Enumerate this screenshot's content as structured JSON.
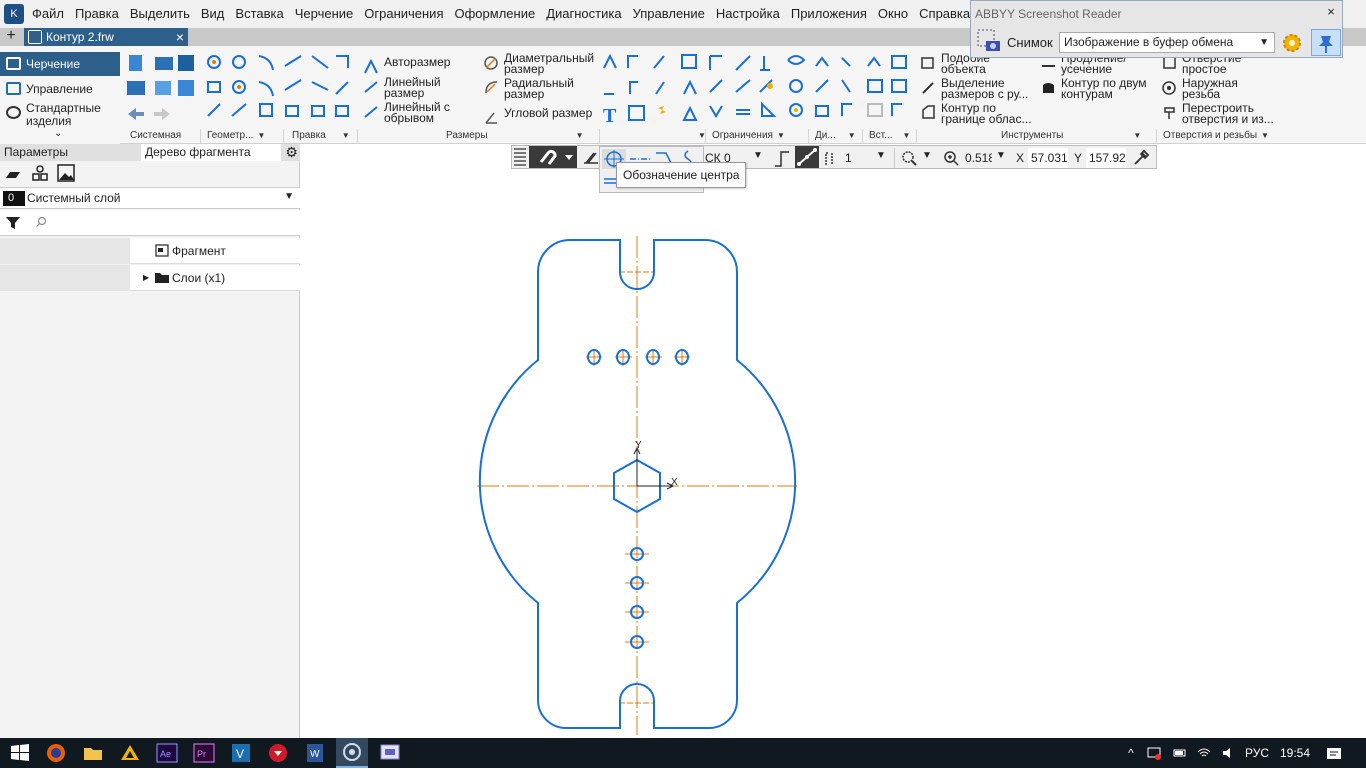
{
  "menu": {
    "items": [
      "Файл",
      "Правка",
      "Выделить",
      "Вид",
      "Вставка",
      "Черчение",
      "Ограничения",
      "Оформление",
      "Диагностика",
      "Управление",
      "Настройка",
      "Приложения",
      "Окно",
      "Справка"
    ]
  },
  "tabs": {
    "document": "Контур 2.frw"
  },
  "ribbon": {
    "modes": {
      "drawing": "Черчение",
      "management": "Управление",
      "standard": "Стандартные изделия"
    },
    "groups": {
      "system": "Системная",
      "geometry": "Геометр...",
      "edit": "Правка",
      "dimensions": "Размеры",
      "constraints": "Ограничения",
      "diagnostics": "Ди...",
      "insert": "Вст...",
      "tools": "Инструменты",
      "holes": "Отверстия и резьбы"
    },
    "dimensions": {
      "auto": "Авторазмер",
      "linear": "Линейный размер",
      "linear_break": "Линейный с обрывом",
      "diameter": "Диаметральный размер",
      "radial": "Радиальный размер",
      "angular": "Угловой размер"
    },
    "tools": {
      "similar": "Подобие объекта",
      "extend": "Продление/ усечение",
      "highlight": "Выделение размеров с ру...",
      "two_contours": "Контур по двум контурам",
      "contour_region": "Контур по границе облас..."
    },
    "holes": {
      "simple": "Отверстие простое",
      "thread": "Наружная резьба",
      "rebuild": "Перестроить отверстия и из..."
    }
  },
  "abbyy": {
    "title": "ABBYY Screenshot Reader",
    "snapshot_label": "Снимок",
    "mode_value": "Изображение в буфер обмена"
  },
  "left_panel": {
    "tab_params": "Параметры",
    "tab_tree": "Дерево фрагмента",
    "layer_number": "0",
    "layer_name": "Системный слой",
    "tree": {
      "fragment": "Фрагмент",
      "layers": "Слои (х1)"
    }
  },
  "float_toolbar": {
    "cs": "СК 0",
    "step": "1",
    "zoom": "0.518",
    "x_label": "X",
    "x_value": "57.0312",
    "y_label": "Y",
    "y_value": "157.926"
  },
  "tooltip": "Обозначение центра",
  "drawing": {
    "axis_y": "Y",
    "axis_x": "X",
    "line_color": "#1a6fd4",
    "axis_color": "#e07a10"
  },
  "taskbar": {
    "lang": "РУС",
    "time": "19:54"
  },
  "colors": {
    "accent": "#2d5f8b",
    "taskbar": "#101820"
  }
}
